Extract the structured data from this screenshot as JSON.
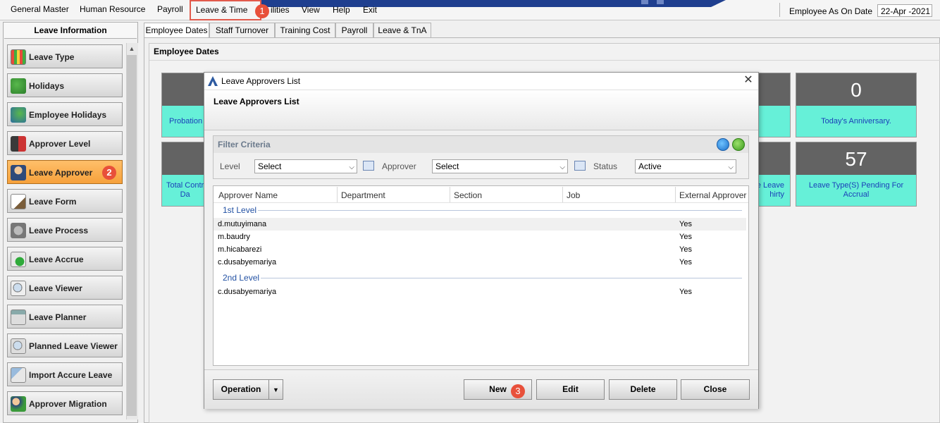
{
  "menu": {
    "items": [
      "General Master",
      "Human Resource",
      "Payroll",
      "Leave & Time",
      "ilities",
      "View",
      "Help",
      "Exit"
    ],
    "employee_as_on_label": "Employee As On Date",
    "employee_as_on_value": "22-Apr -2021"
  },
  "badges": [
    "1",
    "2",
    "3"
  ],
  "left_panel": {
    "title": "Leave Information",
    "items": [
      {
        "label": "Leave Type",
        "icon": "calendar-table-icon"
      },
      {
        "label": "Holidays",
        "icon": "holiday-tree-icon"
      },
      {
        "label": "Employee Holidays",
        "icon": "employee-holiday-icon"
      },
      {
        "label": "Approver Level",
        "icon": "approver-level-icon"
      },
      {
        "label": "Leave Approver",
        "icon": "leave-approver-icon"
      },
      {
        "label": "Leave Form",
        "icon": "leave-form-icon"
      },
      {
        "label": "Leave Process",
        "icon": "leave-process-icon"
      },
      {
        "label": "Leave Accrue",
        "icon": "leave-accrue-icon"
      },
      {
        "label": "Leave Viewer",
        "icon": "leave-viewer-icon"
      },
      {
        "label": "Leave Planner",
        "icon": "leave-planner-icon"
      },
      {
        "label": "Planned Leave Viewer",
        "icon": "planned-leave-viewer-icon"
      },
      {
        "label": "Import Accure Leave",
        "icon": "import-accrue-icon"
      },
      {
        "label": "Approver Migration",
        "icon": "approver-migration-icon"
      }
    ]
  },
  "tabs": [
    "Employee Dates",
    "Staff Turnover",
    "Training Cost",
    "Payroll",
    "Leave & TnA"
  ],
  "main": {
    "title": "Employee Dates",
    "cards": {
      "probation_caption": "Probation",
      "total_caption": "Total Contr\nDa",
      "anniv_value": "0",
      "anniv_caption": "Today's Anniversary.",
      "leave_expiry_caption": "e Leave\nhirty",
      "pending_value": "57",
      "pending_caption": "Leave Type(S) Pending For Accrual"
    }
  },
  "dialog": {
    "title": "Leave Approvers List",
    "heading": "Leave Approvers List",
    "filter": {
      "title": "Filter Criteria",
      "level_label": "Level",
      "level_value": "Select",
      "approver_label": "Approver",
      "approver_value": "Select",
      "status_label": "Status",
      "status_value": "Active"
    },
    "columns": [
      "Approver Name",
      "Department",
      "Section",
      "Job",
      "External Approver"
    ],
    "groups": [
      {
        "name": "1st Level",
        "rows": [
          {
            "name": "d.mutuyimana",
            "external": "Yes"
          },
          {
            "name": "m.baudry",
            "external": "Yes"
          },
          {
            "name": "m.hicabarezi",
            "external": "Yes"
          },
          {
            "name": "c.dusabyemariya",
            "external": "Yes"
          }
        ]
      },
      {
        "name": "2nd Level",
        "rows": [
          {
            "name": "c.dusabyemariya",
            "external": "Yes"
          }
        ]
      }
    ],
    "buttons": {
      "operation": "Operation",
      "new": "New",
      "edit": "Edit",
      "delete": "Delete",
      "close": "Close"
    }
  }
}
